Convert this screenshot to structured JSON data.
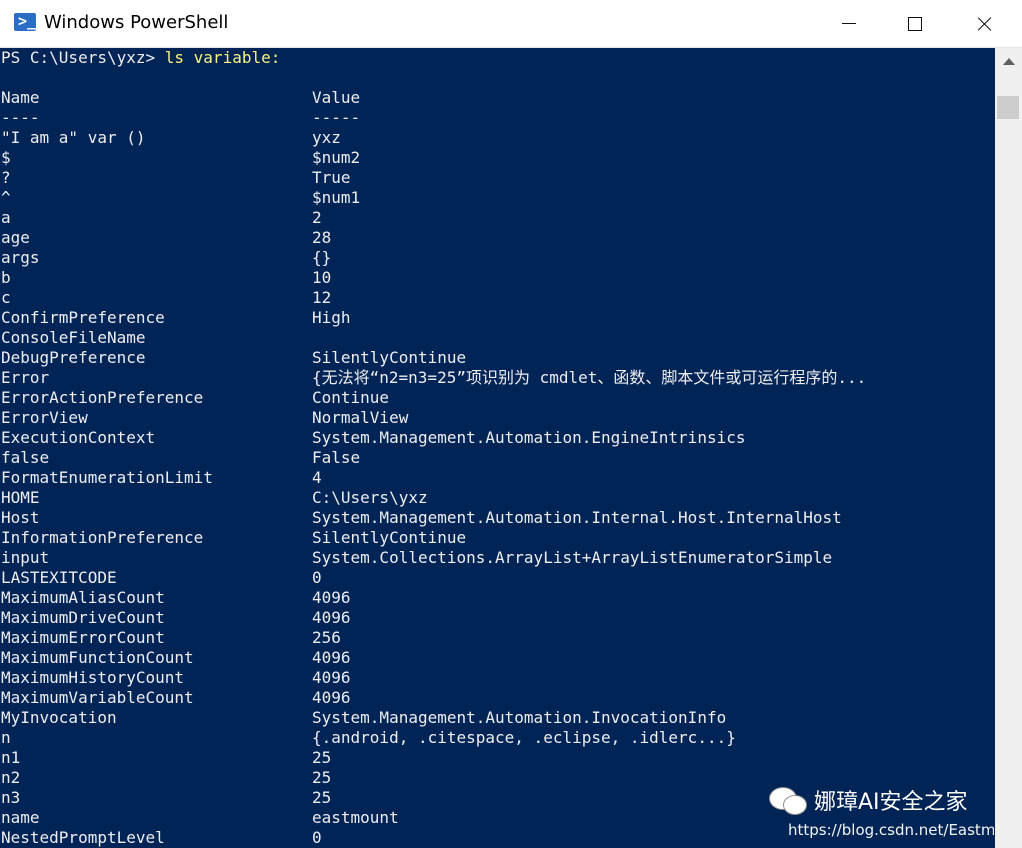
{
  "window": {
    "title": "Windows PowerShell",
    "icon": "powershell-icon",
    "icon_glyph": ">_"
  },
  "console": {
    "prompt": "PS C:\\Users\\yxz> ",
    "command": "ls variable:",
    "header": {
      "name": "Name",
      "value": "Value"
    },
    "separator": {
      "name": "----",
      "value": "-----"
    },
    "rows": [
      {
        "name": "\"I am a\" var ()",
        "value": "yxz"
      },
      {
        "name": "$",
        "value": "$num2"
      },
      {
        "name": "?",
        "value": "True"
      },
      {
        "name": "^",
        "value": "$num1"
      },
      {
        "name": "a",
        "value": "2"
      },
      {
        "name": "age",
        "value": "28"
      },
      {
        "name": "args",
        "value": "{}"
      },
      {
        "name": "b",
        "value": "10"
      },
      {
        "name": "c",
        "value": "12"
      },
      {
        "name": "ConfirmPreference",
        "value": "High"
      },
      {
        "name": "ConsoleFileName",
        "value": ""
      },
      {
        "name": "DebugPreference",
        "value": "SilentlyContinue"
      },
      {
        "name": "Error",
        "value": "{无法将“n2=n3=25”项识别为 cmdlet、函数、脚本文件或可运行程序的..."
      },
      {
        "name": "ErrorActionPreference",
        "value": "Continue"
      },
      {
        "name": "ErrorView",
        "value": "NormalView"
      },
      {
        "name": "ExecutionContext",
        "value": "System.Management.Automation.EngineIntrinsics"
      },
      {
        "name": "false",
        "value": "False"
      },
      {
        "name": "FormatEnumerationLimit",
        "value": "4"
      },
      {
        "name": "HOME",
        "value": "C:\\Users\\yxz"
      },
      {
        "name": "Host",
        "value": "System.Management.Automation.Internal.Host.InternalHost"
      },
      {
        "name": "InformationPreference",
        "value": "SilentlyContinue"
      },
      {
        "name": "input",
        "value": "System.Collections.ArrayList+ArrayListEnumeratorSimple"
      },
      {
        "name": "LASTEXITCODE",
        "value": "0"
      },
      {
        "name": "MaximumAliasCount",
        "value": "4096"
      },
      {
        "name": "MaximumDriveCount",
        "value": "4096"
      },
      {
        "name": "MaximumErrorCount",
        "value": "256"
      },
      {
        "name": "MaximumFunctionCount",
        "value": "4096"
      },
      {
        "name": "MaximumHistoryCount",
        "value": "4096"
      },
      {
        "name": "MaximumVariableCount",
        "value": "4096"
      },
      {
        "name": "MyInvocation",
        "value": "System.Management.Automation.InvocationInfo"
      },
      {
        "name": "n",
        "value": "{.android, .citespace, .eclipse, .idlerc...}"
      },
      {
        "name": "n1",
        "value": "25"
      },
      {
        "name": "n2",
        "value": "25"
      },
      {
        "name": "n3",
        "value": "25"
      },
      {
        "name": "name",
        "value": "eastmount"
      },
      {
        "name": "NestedPromptLevel",
        "value": "0"
      }
    ]
  },
  "watermark": {
    "icon": "wechat-icon",
    "text": "娜璋AI安全之家",
    "url": "https://blog.csdn.net/Eastmou"
  },
  "colors": {
    "console_bg": "#012456",
    "console_fg": "#eeedf0",
    "command": "#f8f57b"
  }
}
